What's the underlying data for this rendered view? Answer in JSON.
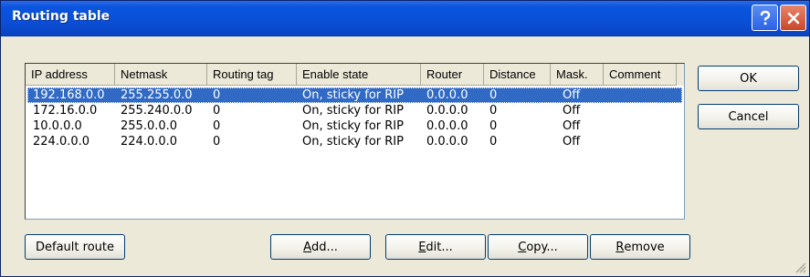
{
  "window": {
    "title": "Routing table"
  },
  "columns": [
    "IP address",
    "Netmask",
    "Routing tag",
    "Enable state",
    "Router",
    "Distance",
    "Mask.",
    "Comment"
  ],
  "rows": [
    {
      "ip": "192.168.0.0",
      "mask": "255.255.0.0",
      "tag": "0",
      "state": "On, sticky for RIP",
      "router": "0.0.0.0",
      "distance": "0",
      "masq": "Off",
      "comment": "",
      "selected": true
    },
    {
      "ip": "172.16.0.0",
      "mask": "255.240.0.0",
      "tag": "0",
      "state": "On, sticky for RIP",
      "router": "0.0.0.0",
      "distance": "0",
      "masq": "Off",
      "comment": ""
    },
    {
      "ip": "10.0.0.0",
      "mask": "255.0.0.0",
      "tag": "0",
      "state": "On, sticky for RIP",
      "router": "0.0.0.0",
      "distance": "0",
      "masq": "Off",
      "comment": ""
    },
    {
      "ip": "224.0.0.0",
      "mask": "224.0.0.0",
      "tag": "0",
      "state": "On, sticky for RIP",
      "router": "0.0.0.0",
      "distance": "0",
      "masq": "Off",
      "comment": ""
    }
  ],
  "buttons": {
    "ok": "OK",
    "cancel": "Cancel",
    "default_route": "Default route",
    "add": {
      "u": "A",
      "rest": "dd..."
    },
    "edit": {
      "u": "E",
      "rest": "dit..."
    },
    "copy": {
      "u": "C",
      "rest": "opy..."
    },
    "remove": {
      "u": "R",
      "rest": "emove"
    }
  },
  "colors": {
    "title_bar": "#0a55df",
    "selection": "#316ac5",
    "dialog_bg": "#ece9d8"
  },
  "icons": {
    "help": "help-icon",
    "close": "close-icon",
    "resize": "resize-grip-icon"
  }
}
